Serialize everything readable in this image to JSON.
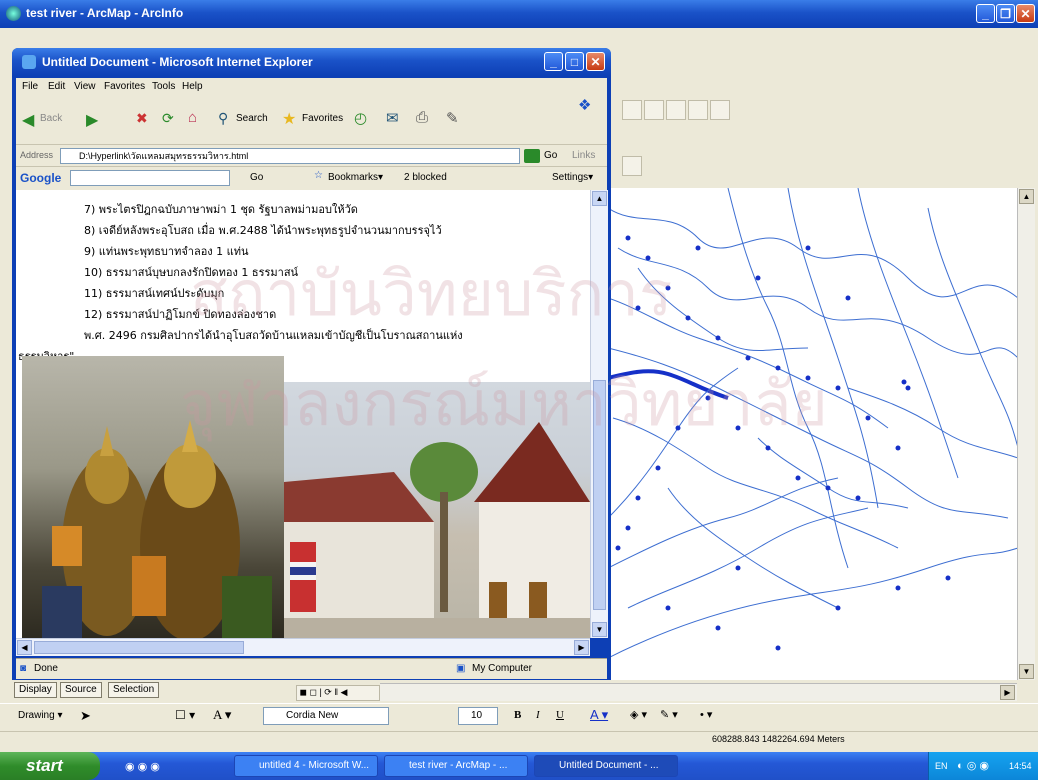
{
  "arcmap": {
    "title": "test river - ArcMap - ArcInfo",
    "view_tabs": [
      "Display",
      "Source",
      "Selection"
    ],
    "drawing_label": "Drawing ▾",
    "font_value": "Cordia New",
    "font_size_value": "10",
    "coordinates": "608288.843  1482264.694 Meters"
  },
  "ie": {
    "title": "Untitled Document - Microsoft Internet Explorer",
    "menu": [
      "File",
      "Edit",
      "View",
      "Favorites",
      "Tools",
      "Help"
    ],
    "toolbar": {
      "back": "Back",
      "search": "Search",
      "favorites": "Favorites"
    },
    "address_label": "Address",
    "address_value": "D:\\Hyperlink\\วัดแหลมสมุทรธรรมวิหาร.html",
    "go_label": "Go",
    "links_label": "Links",
    "google": {
      "logo": "Google",
      "go": "Go",
      "bookmarks": "Bookmarks▾",
      "blocked": "2 blocked",
      "settings": "Settings▾"
    },
    "status_done": "Done",
    "status_zone": "My Computer",
    "content_lines": [
      "7) พระไตรปิฎกฉบับภาษาพม่า 1 ชุด รัฐบาลพม่ามอบให้วัด",
      "8) เจดีย์หลังพระอุโบสถ เมื่อ พ.ศ.2488 ได้นำพระพุทธรูปจำนวนมากบรรจุไว้",
      "9) แท่นพระพุทธบาทจำลอง 1 แท่น",
      "10) ธรรมาสน์บุษบกลงรักปิดทอง 1 ธรรมาสน์",
      "11) ธรรมาสน์เทศน์ประดับมุก",
      "12) ธรรมาสน์ปาฏิโมกข์ ปิดทองล่องชาด",
      "พ.ศ. 2496 กรมศิลปากรได้นำอุโบสถวัดบ้านแหลมเข้าบัญชีเป็นโบราณสถานแห่ง",
      "ธรรมวิหาร\""
    ]
  },
  "taskbar": {
    "start": "start",
    "tasks": [
      "untitled 4 - Microsoft W...",
      "test river - ArcMap - ...",
      "Untitled Document - ..."
    ],
    "lang": "EN",
    "clock": "14:54"
  },
  "colors": {
    "xp_blue": "#0d3fb5",
    "map_line": "#3d6ed1",
    "map_point": "#1530c8",
    "taskbar": "#2458d6",
    "start_green": "#2f8c2a"
  }
}
